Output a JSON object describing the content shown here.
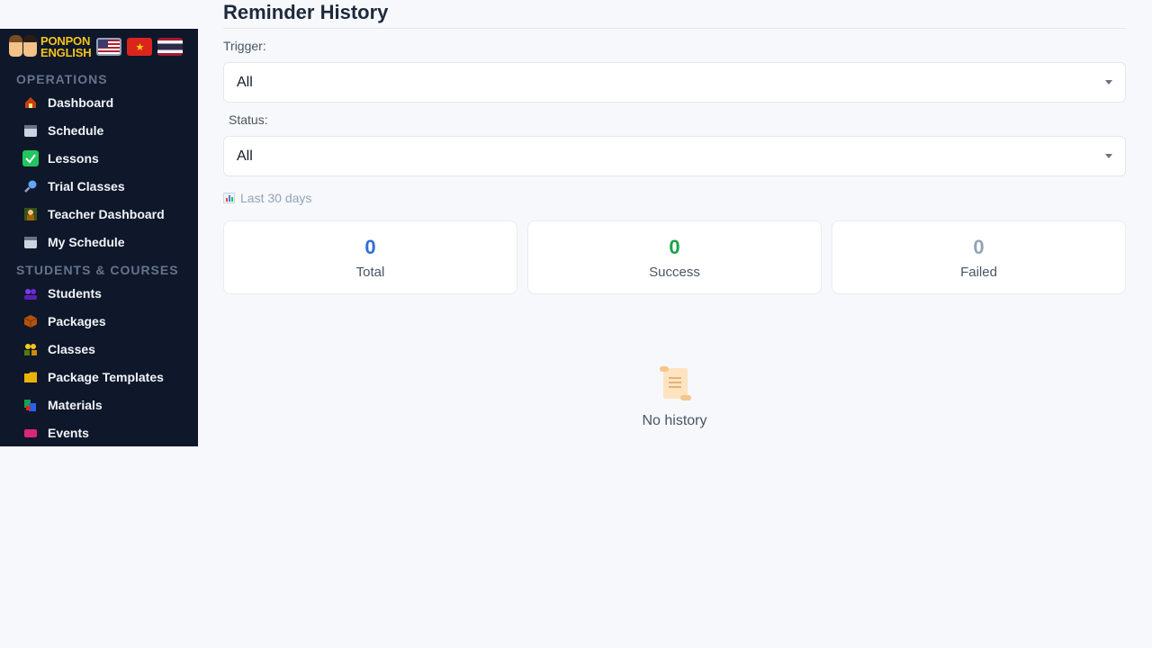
{
  "brand": {
    "line1": "PONPON",
    "line2": "ENGLISH"
  },
  "languages": [
    "us-flag-icon",
    "vn-flag-icon",
    "th-flag-icon"
  ],
  "sidebar": {
    "sections": [
      {
        "label": "OPERATIONS",
        "items": [
          {
            "label": "Dashboard",
            "icon": "house-icon"
          },
          {
            "label": "Schedule",
            "icon": "calendar-icon"
          },
          {
            "label": "Lessons",
            "icon": "checkmark-icon"
          },
          {
            "label": "Trial Classes",
            "icon": "magnifier-icon"
          },
          {
            "label": "Teacher Dashboard",
            "icon": "teacher-icon"
          },
          {
            "label": "My Schedule",
            "icon": "calendar-icon"
          }
        ]
      },
      {
        "label": "STUDENTS & COURSES",
        "items": [
          {
            "label": "Students",
            "icon": "people-icon"
          },
          {
            "label": "Packages",
            "icon": "package-icon"
          },
          {
            "label": "Classes",
            "icon": "group-icon"
          },
          {
            "label": "Package Templates",
            "icon": "folder-icon"
          },
          {
            "label": "Materials",
            "icon": "books-icon"
          },
          {
            "label": "Events",
            "icon": "ticket-icon"
          }
        ]
      }
    ]
  },
  "main": {
    "title": "Reminder History",
    "trigger": {
      "label": "Trigger:",
      "value": "All"
    },
    "status": {
      "label": "Status:",
      "value": "All"
    },
    "range": "Last 30 days",
    "stats": [
      {
        "value": "0",
        "label": "Total",
        "color": "#2f6fd6"
      },
      {
        "value": "0",
        "label": "Success",
        "color": "#16a34a"
      },
      {
        "value": "0",
        "label": "Failed",
        "color": "#94a3b8"
      }
    ],
    "empty": "No history"
  }
}
